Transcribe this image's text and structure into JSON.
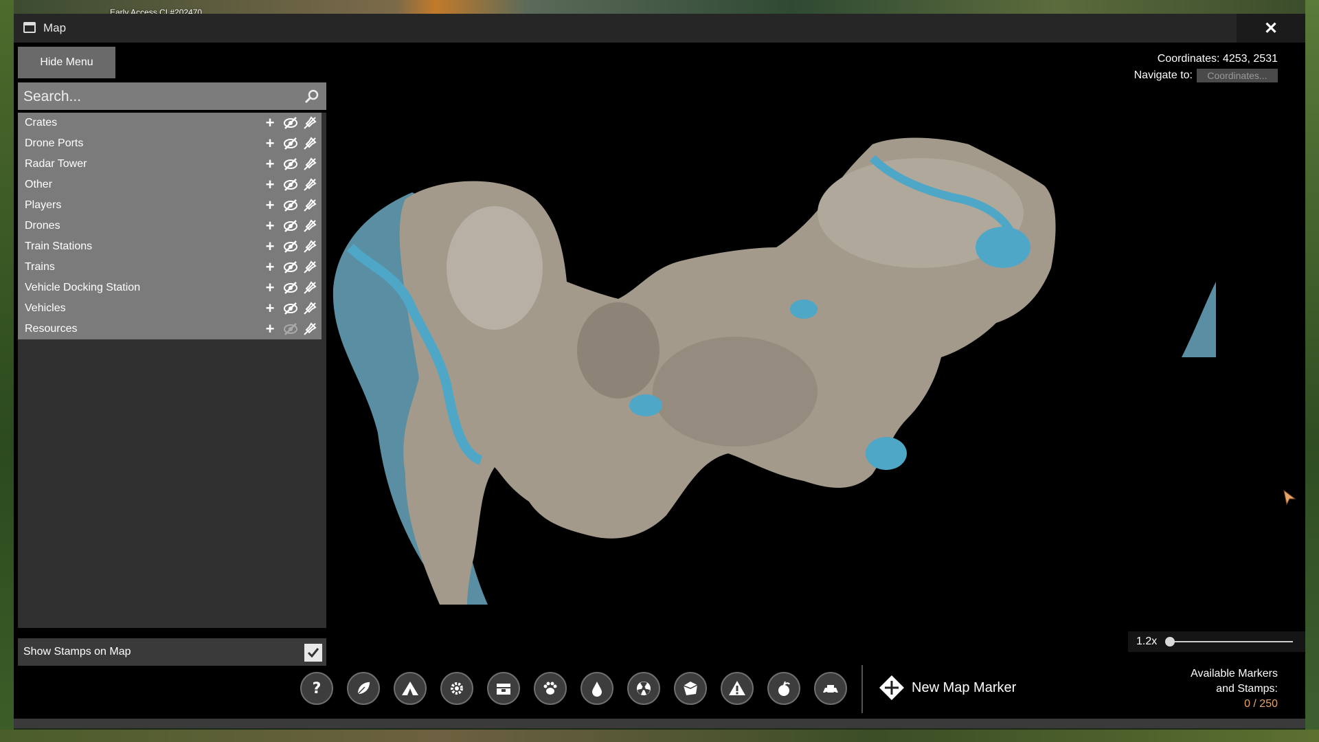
{
  "build": "Early Access CL#202470",
  "window": {
    "title": "Map",
    "close": "✕"
  },
  "menu": {
    "hide_label": "Hide Menu"
  },
  "search": {
    "placeholder": "Search..."
  },
  "categories": [
    {
      "label": "Crates",
      "eye_disabled": false
    },
    {
      "label": "Drone Ports",
      "eye_disabled": false
    },
    {
      "label": "Radar Tower",
      "eye_disabled": false
    },
    {
      "label": "Other",
      "eye_disabled": false
    },
    {
      "label": "Players",
      "eye_disabled": false
    },
    {
      "label": "Drones",
      "eye_disabled": false
    },
    {
      "label": "Train Stations",
      "eye_disabled": false
    },
    {
      "label": "Trains",
      "eye_disabled": false
    },
    {
      "label": "Vehicle Docking Station",
      "eye_disabled": false
    },
    {
      "label": "Vehicles",
      "eye_disabled": false
    },
    {
      "label": "Resources",
      "eye_disabled": true
    }
  ],
  "stamps": {
    "label": "Show Stamps on Map",
    "checked": true
  },
  "info": {
    "coordinates_text": "Coordinates:  4253, 2531",
    "navigate_label": "Navigate to:",
    "navigate_placeholder": "Coordinates..."
  },
  "zoom": {
    "label": "1.2x",
    "level": 0.0
  },
  "toolbar": {
    "icons": [
      "question-icon",
      "leaf-icon",
      "tent-icon",
      "gear-icon",
      "crate-icon",
      "paw-icon",
      "water-drop-icon",
      "radiation-icon",
      "ore-icon",
      "warning-icon",
      "fruit-icon",
      "vehicle-icon"
    ],
    "new_marker_label": "New Map Marker"
  },
  "available": {
    "line1": "Available Markers",
    "line2": "and Stamps:",
    "count": "0 / 250"
  },
  "colors": {
    "land": "#a39a8c",
    "water": "#4ea7c6",
    "deep_water": "#5a8ea3",
    "panel": "#7b7b7b",
    "accent": "#e8a468"
  }
}
